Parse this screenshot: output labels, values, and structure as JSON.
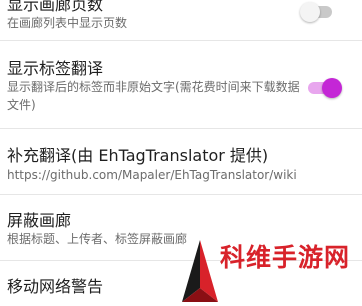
{
  "settings": {
    "gallery_pages": {
      "title": "显示画廊页数",
      "summary": "在画廊列表中显示页数",
      "enabled": false
    },
    "tag_translation": {
      "title": "显示标签翻译",
      "summary": "显示翻译后的标签而非原始文字(需花费时间来下载数据文件)",
      "enabled": true
    },
    "extra_translation": {
      "title": "补充翻译(由 EhTagTranslator 提供)",
      "summary": "https://github.com/Mapaler/EhTagTranslator/wiki"
    },
    "block_gallery": {
      "title": "屏蔽画廊",
      "summary": "根据标题、上传者、标签屏蔽画廊"
    },
    "mobile_network_warning": {
      "title": "移动网络警告"
    }
  },
  "colors": {
    "accent": "#c426d6",
    "accent_track": "#e8a6ee",
    "watermark": "#d8222a"
  },
  "watermark": {
    "text": "科维手游网"
  }
}
